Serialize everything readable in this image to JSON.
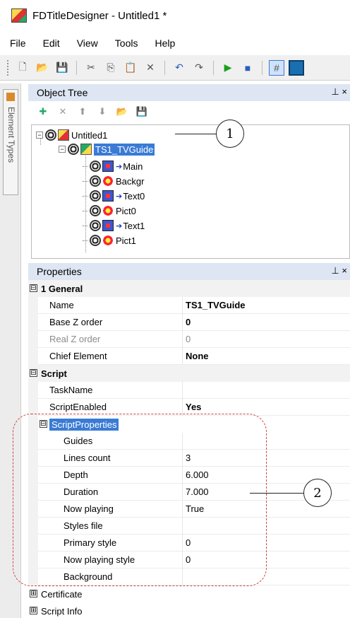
{
  "window": {
    "title": "FDTitleDesigner - Untitled1 *"
  },
  "menu": [
    "File",
    "Edit",
    "View",
    "Tools",
    "Help"
  ],
  "toolbar": {
    "icons": [
      "new-icon",
      "open-icon",
      "save-icon",
      "cut-icon",
      "copy-icon",
      "paste-icon",
      "delete-icon",
      "undo-icon",
      "redo-icon",
      "play-icon",
      "stop-icon",
      "grid-icon",
      "view-icon"
    ]
  },
  "side_tab": {
    "label": "Element Types"
  },
  "object_tree": {
    "title": "Object Tree",
    "pin": "⊥ ×",
    "nodes": [
      {
        "label": "Untitled1",
        "icon": "fd-icon"
      },
      {
        "label": "TS1_TVGuide",
        "icon": "ts-icon"
      },
      {
        "label": "Main",
        "icon": "text-icon"
      },
      {
        "label": "Backgr",
        "icon": "picture-icon"
      },
      {
        "label": "Text0",
        "icon": "text-icon"
      },
      {
        "label": "Pict0",
        "icon": "picture-icon"
      },
      {
        "label": "Text1",
        "icon": "text-icon"
      },
      {
        "label": "Pict1",
        "icon": "picture-icon"
      }
    ]
  },
  "callouts": {
    "one": "1",
    "two": "2"
  },
  "properties": {
    "title": "Properties",
    "pin": "⊥ ×",
    "categories": {
      "general": "1 General",
      "script": "Script",
      "script_props": "ScriptProperties",
      "certificate": "Certificate",
      "script_info": "Script Info"
    },
    "general": [
      {
        "name": "Name",
        "value": "TS1_TVGuide"
      },
      {
        "name": "Base Z order",
        "value": "0"
      },
      {
        "name": "Real Z order",
        "value": "0"
      },
      {
        "name": "Chief Element",
        "value": "None"
      }
    ],
    "script": [
      {
        "name": "TaskName",
        "value": ""
      },
      {
        "name": "ScriptEnabled",
        "value": "Yes"
      }
    ],
    "script_properties": [
      {
        "name": "Guides",
        "value": ""
      },
      {
        "name": "Lines count",
        "value": "3"
      },
      {
        "name": "Depth",
        "value": "6.000"
      },
      {
        "name": "Duration",
        "value": "7.000"
      },
      {
        "name": "Now playing",
        "value": "True"
      },
      {
        "name": "Styles file",
        "value": ""
      },
      {
        "name": "Primary style",
        "value": "0"
      },
      {
        "name": "Now playing style",
        "value": "0"
      },
      {
        "name": "Background",
        "value": ""
      }
    ],
    "expander": {
      "open": "⊟",
      "closed": "⊞"
    }
  }
}
